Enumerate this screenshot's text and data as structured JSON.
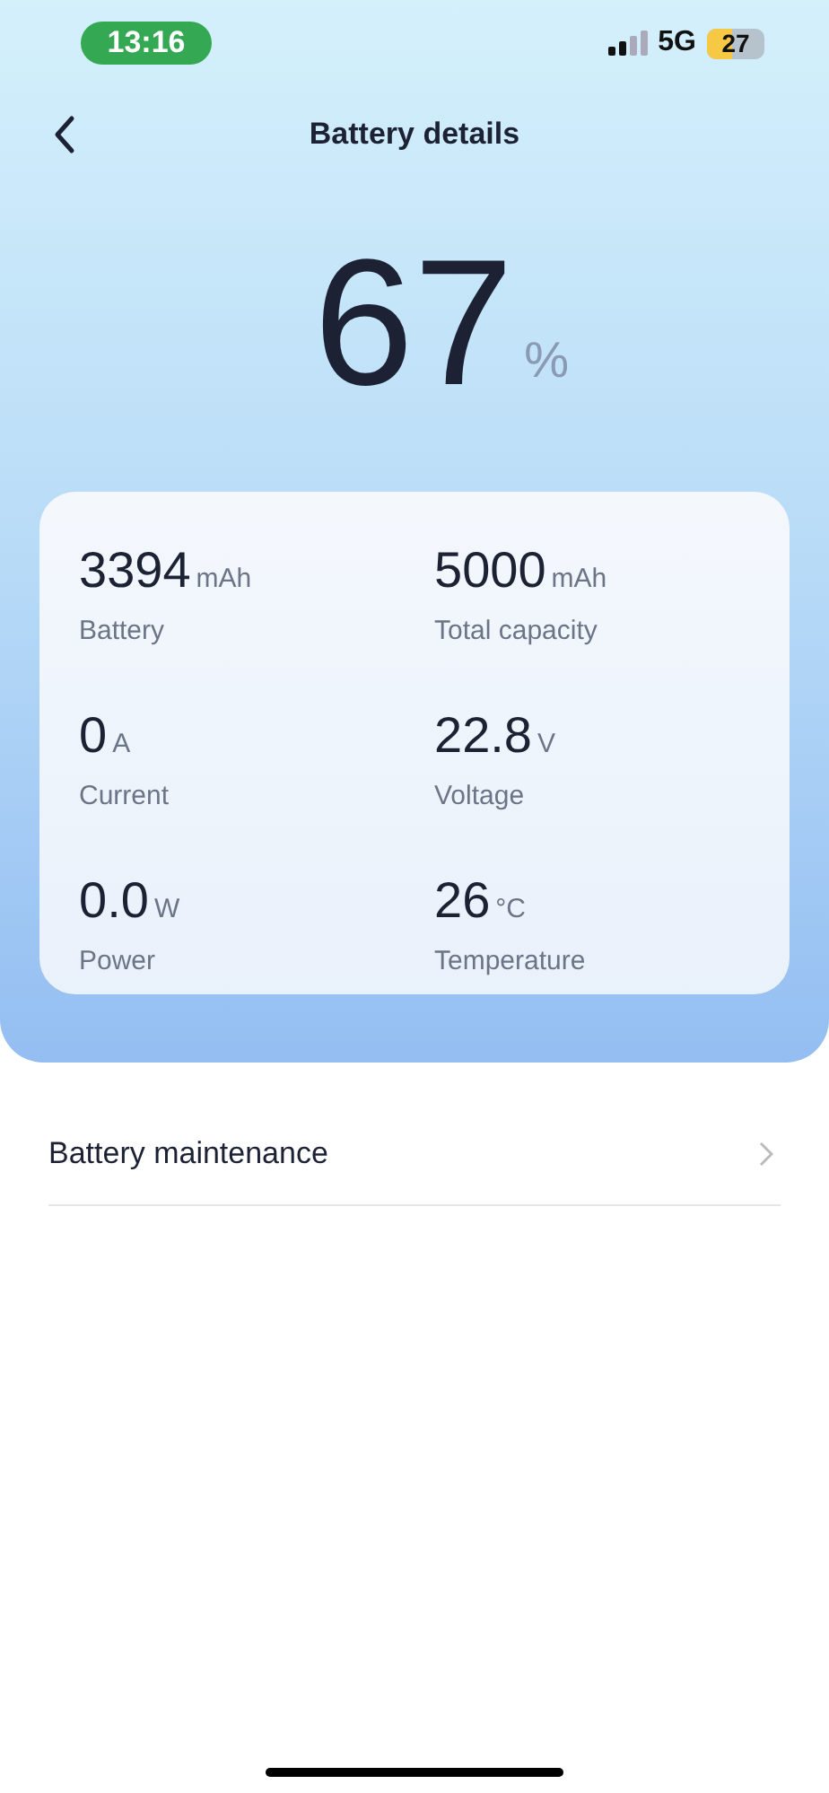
{
  "status_bar": {
    "time": "13:16",
    "network": "5G",
    "battery": "27"
  },
  "header": {
    "title": "Battery details"
  },
  "charge": {
    "value": "67",
    "unit": "%"
  },
  "stats": [
    {
      "value": "3394",
      "unit": "mAh",
      "label": "Battery"
    },
    {
      "value": "5000",
      "unit": "mAh",
      "label": "Total capacity"
    },
    {
      "value": "0",
      "unit": "A",
      "label": "Current"
    },
    {
      "value": "22.8",
      "unit": "V",
      "label": "Voltage"
    },
    {
      "value": "0.0",
      "unit": "W",
      "label": "Power"
    },
    {
      "value": "26",
      "unit": "°C",
      "label": "Temperature"
    }
  ],
  "menu": [
    {
      "label": "Battery maintenance"
    }
  ]
}
